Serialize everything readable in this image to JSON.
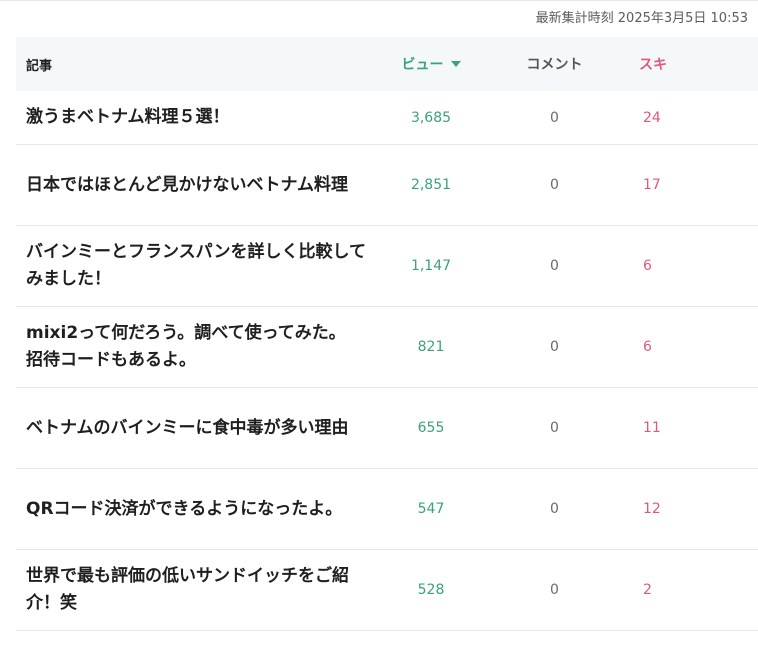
{
  "header": {
    "last_updated": "最新集計時刻 2025年3月5日 10:53"
  },
  "table": {
    "columns": {
      "title": "記事",
      "views": "ビュー",
      "comments": "コメント",
      "likes": "スキ"
    },
    "sort": {
      "column": "views",
      "direction": "desc"
    },
    "rows": [
      {
        "title": "激うまベトナム料理５選！",
        "views": "3,685",
        "comments": "0",
        "likes": "24"
      },
      {
        "title": "日本ではほとんど見かけないベトナム料理",
        "views": "2,851",
        "comments": "0",
        "likes": "17"
      },
      {
        "title": "バインミーとフランスパンを詳しく比較してみました！",
        "views": "1,147",
        "comments": "0",
        "likes": "6"
      },
      {
        "title": "mixi2って何だろう。調べて使ってみた。　招待コードもあるよ。",
        "views": "821",
        "comments": "0",
        "likes": "6"
      },
      {
        "title": "ベトナムのバインミーに食中毒が多い理由",
        "views": "655",
        "comments": "0",
        "likes": "11"
      },
      {
        "title": "QRコード決済ができるようになったよ。",
        "views": "547",
        "comments": "0",
        "likes": "12"
      },
      {
        "title": "世界で最も評価の低いサンドイッチをご紹介！笑",
        "views": "528",
        "comments": "0",
        "likes": "2"
      }
    ]
  },
  "colors": {
    "views": "#3aa37b",
    "likes": "#e0587b",
    "header_bg": "#f5f8fa"
  }
}
